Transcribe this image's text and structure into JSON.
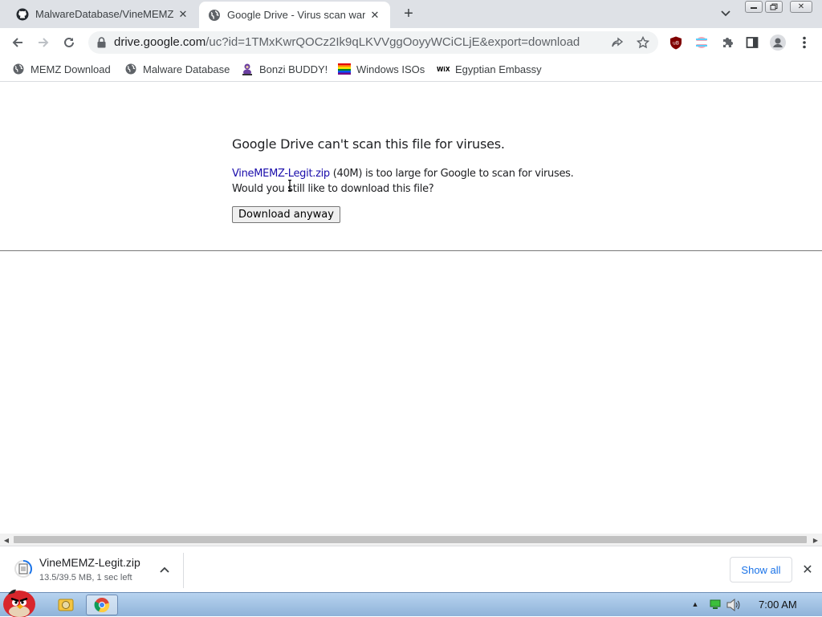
{
  "tabs": [
    {
      "title": "MalwareDatabase/VineMEMZ",
      "icon": "github-icon",
      "active": false
    },
    {
      "title": "Google Drive - Virus scan warning",
      "icon": "globe-icon",
      "active": true
    }
  ],
  "window_controls": {
    "minimize": "minimize-icon",
    "maximize": "maximize-icon",
    "close": "close-icon"
  },
  "toolbar": {
    "url_host": "drive.google.com",
    "url_path": "/uc?id=1TMxKwrQOCz2Ik9qLKVVggOoyyWCiCLjE&export=download"
  },
  "bookmarks": [
    {
      "label": "MEMZ Download",
      "icon": "globe-icon"
    },
    {
      "label": "Malware Database",
      "icon": "globe-icon"
    },
    {
      "label": "Bonzi BUDDY!",
      "icon": "bonzi-icon"
    },
    {
      "label": "Windows ISOs",
      "icon": "rainbow-flag-icon"
    },
    {
      "label": "Egyptian Embassy",
      "icon": "wix-icon"
    }
  ],
  "page": {
    "heading": "Google Drive can't scan this file for viruses.",
    "file_link": "VineMEMZ-Legit.zip",
    "message_rest": " (40M) is too large for Google to scan for viruses. Would you still like to download this file?",
    "button": "Download anyway"
  },
  "download": {
    "file_name": "VineMEMZ-Legit.zip",
    "status": "13.5/39.5 MB, 1 sec left",
    "show_all": "Show all"
  },
  "taskbar": {
    "clock": "7:00 AM"
  },
  "colors": {
    "link": "#1a0dab",
    "show_all": "#1a73e8",
    "tabstrip": "#dee1e6"
  }
}
